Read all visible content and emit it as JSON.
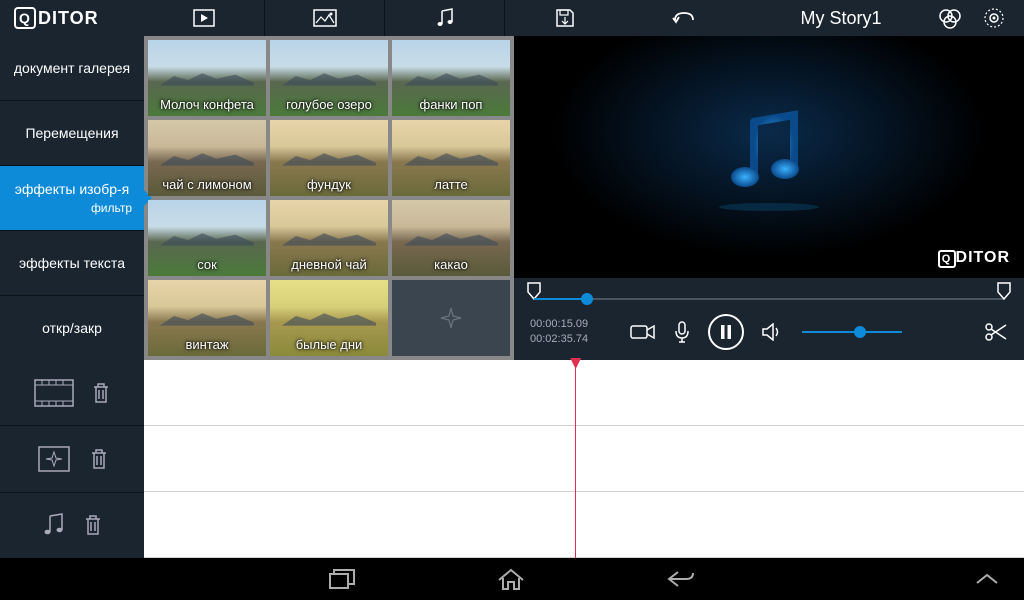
{
  "app": {
    "name": "QDITOR",
    "watermark": "DITOR"
  },
  "project": {
    "title": "My Story1"
  },
  "sidebar": {
    "items": [
      {
        "label": "документ галерея"
      },
      {
        "label": "Перемещения"
      },
      {
        "label": "эффекты изобр-я",
        "sub": "фильтр"
      },
      {
        "label": "эффекты текста"
      },
      {
        "label": "откр/закр"
      }
    ],
    "activeIndex": 2
  },
  "filters": [
    {
      "label": "Молоч конфета"
    },
    {
      "label": "голубое озеро"
    },
    {
      "label": "фанки поп"
    },
    {
      "label": "чай с лимоном"
    },
    {
      "label": "фундук"
    },
    {
      "label": "латте"
    },
    {
      "label": "сок"
    },
    {
      "label": "дневной чай"
    },
    {
      "label": "какао"
    },
    {
      "label": "винтаж"
    },
    {
      "label": "былые дни"
    }
  ],
  "playback": {
    "current": "00:00:15.09",
    "total": "00:02:35.74"
  },
  "icons": {
    "play": "play-icon",
    "image": "image-icon",
    "music": "music-icon",
    "save": "save-icon",
    "undo": "undo-icon",
    "colorwheel": "colorwheel-icon",
    "settings": "settings-icon"
  }
}
